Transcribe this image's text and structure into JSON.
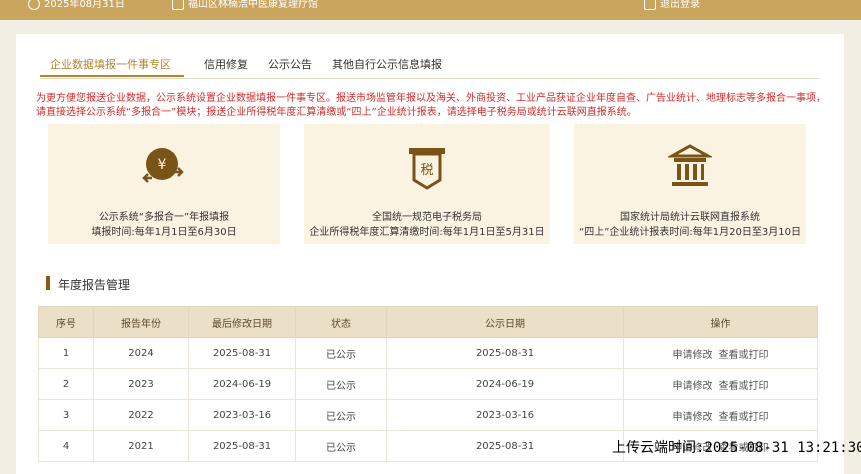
{
  "topbar": {
    "date": "2025年08月31日",
    "org": "福山区林楠浩中医康复理疗馆",
    "logout": "退出登录"
  },
  "tabs": [
    {
      "label": "企业数据填报一件事专区"
    },
    {
      "label": "信用修复"
    },
    {
      "label": "公示公告"
    },
    {
      "label": "其他自行公示信息填报"
    }
  ],
  "notice": "为更方便您报送企业数据，公示系统设置企业数据填报一件事专区。报送市场监管年报以及海关、外商投资、工业产品获证企业年度自查、广告业统计、地理标志等多报合一事项，请直接选择公示系统“多报合一”模块；报送企业所得税年度汇算清缴或“四上”企业统计报表，请选择电子税务局或统计云联网直报系统。",
  "cards": [
    {
      "icon": "hands-coin-icon",
      "line1": "公示系统“多报合一”年报填报",
      "line2": "填报时间:每年1月1日至6月30日"
    },
    {
      "icon": "tax-document-icon",
      "line1": "全国统一规范电子税务局",
      "line2": "企业所得税年度汇算清缴时间:每年1月1日至5月31日"
    },
    {
      "icon": "government-building-icon",
      "line1": "国家统计局统计云联网直报系统",
      "line2": "“四上”企业统计报表时间:每年1月20日至3月10日"
    }
  ],
  "section_title": "年度报告管理",
  "table": {
    "headers": [
      "序号",
      "报告年份",
      "最后修改日期",
      "状态",
      "公示日期",
      "操作"
    ],
    "rows": [
      {
        "no": "1",
        "year": "2024",
        "modified": "2025-08-31",
        "status": "已公示",
        "pubdate": "2025-08-31"
      },
      {
        "no": "2",
        "year": "2023",
        "modified": "2024-06-19",
        "status": "已公示",
        "pubdate": "2024-06-19"
      },
      {
        "no": "3",
        "year": "2022",
        "modified": "2023-03-16",
        "status": "已公示",
        "pubdate": "2023-03-16"
      },
      {
        "no": "4",
        "year": "2021",
        "modified": "2025-08-31",
        "status": "已公示",
        "pubdate": "2025-08-31"
      }
    ],
    "op_modify": "申请修改",
    "op_view": "查看或打印"
  },
  "watermark": "上传云端时间:2025-08-31 13:21:30",
  "colors": {
    "accent": "#b5842b",
    "topbar": "#caa55e",
    "notice": "#d12c2c",
    "card_bg": "#fbf3e2"
  }
}
